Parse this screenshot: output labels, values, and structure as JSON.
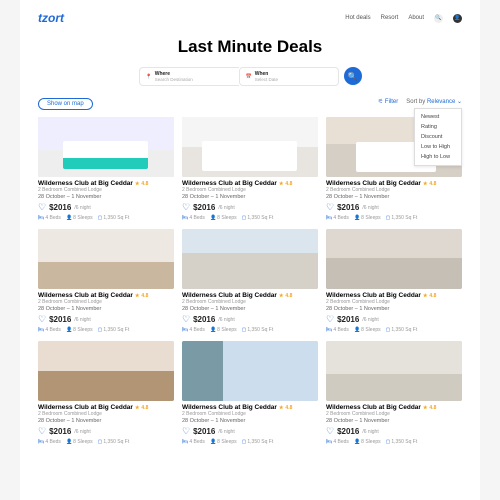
{
  "brand": "tzort",
  "nav": [
    "Hot deals",
    "Resort",
    "About"
  ],
  "title": "Last Minute Deals",
  "search": {
    "where_label": "Where",
    "where_ph": "Search Destination",
    "when_label": "When",
    "when_ph": "Select Date"
  },
  "map_btn": "Show on map",
  "filter": "Filter",
  "sort_label": "Sort by",
  "sort_value": "Relevance",
  "sort_options": [
    "Newest",
    "Rating",
    "Discount",
    "Low to High",
    "High to Low"
  ],
  "card": {
    "title": "Wilderness Club at Big Ceddar",
    "rating": "4.8",
    "sub": "2 Bedroom Combined Lodge",
    "dates": "28 October – 1 November",
    "price": "$2016",
    "per": "/6 night",
    "beds": "4 Beds",
    "sleeps": "8 Sleeps",
    "sqft": "1,350 Sq Ft"
  }
}
